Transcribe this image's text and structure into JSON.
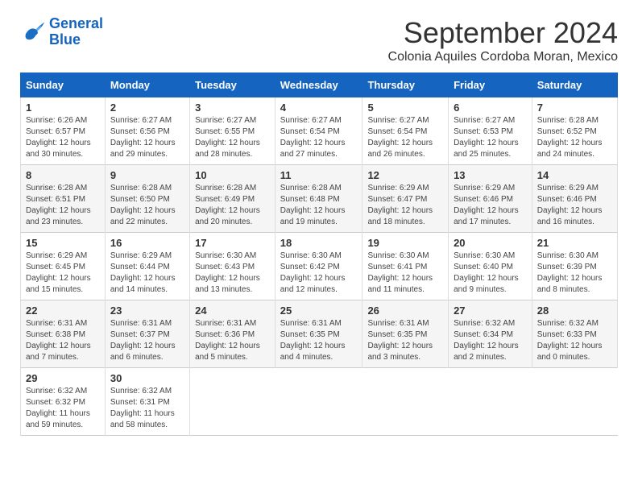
{
  "logo": {
    "line1": "General",
    "line2": "Blue"
  },
  "title": "September 2024",
  "subtitle": "Colonia Aquiles Cordoba Moran, Mexico",
  "days_of_week": [
    "Sunday",
    "Monday",
    "Tuesday",
    "Wednesday",
    "Thursday",
    "Friday",
    "Saturday"
  ],
  "weeks": [
    [
      {
        "day": "1",
        "sunrise": "6:26 AM",
        "sunset": "6:57 PM",
        "daylight": "12 hours and 30 minutes."
      },
      {
        "day": "2",
        "sunrise": "6:27 AM",
        "sunset": "6:56 PM",
        "daylight": "12 hours and 29 minutes."
      },
      {
        "day": "3",
        "sunrise": "6:27 AM",
        "sunset": "6:55 PM",
        "daylight": "12 hours and 28 minutes."
      },
      {
        "day": "4",
        "sunrise": "6:27 AM",
        "sunset": "6:54 PM",
        "daylight": "12 hours and 27 minutes."
      },
      {
        "day": "5",
        "sunrise": "6:27 AM",
        "sunset": "6:54 PM",
        "daylight": "12 hours and 26 minutes."
      },
      {
        "day": "6",
        "sunrise": "6:27 AM",
        "sunset": "6:53 PM",
        "daylight": "12 hours and 25 minutes."
      },
      {
        "day": "7",
        "sunrise": "6:28 AM",
        "sunset": "6:52 PM",
        "daylight": "12 hours and 24 minutes."
      }
    ],
    [
      {
        "day": "8",
        "sunrise": "6:28 AM",
        "sunset": "6:51 PM",
        "daylight": "12 hours and 23 minutes."
      },
      {
        "day": "9",
        "sunrise": "6:28 AM",
        "sunset": "6:50 PM",
        "daylight": "12 hours and 22 minutes."
      },
      {
        "day": "10",
        "sunrise": "6:28 AM",
        "sunset": "6:49 PM",
        "daylight": "12 hours and 20 minutes."
      },
      {
        "day": "11",
        "sunrise": "6:28 AM",
        "sunset": "6:48 PM",
        "daylight": "12 hours and 19 minutes."
      },
      {
        "day": "12",
        "sunrise": "6:29 AM",
        "sunset": "6:47 PM",
        "daylight": "12 hours and 18 minutes."
      },
      {
        "day": "13",
        "sunrise": "6:29 AM",
        "sunset": "6:46 PM",
        "daylight": "12 hours and 17 minutes."
      },
      {
        "day": "14",
        "sunrise": "6:29 AM",
        "sunset": "6:46 PM",
        "daylight": "12 hours and 16 minutes."
      }
    ],
    [
      {
        "day": "15",
        "sunrise": "6:29 AM",
        "sunset": "6:45 PM",
        "daylight": "12 hours and 15 minutes."
      },
      {
        "day": "16",
        "sunrise": "6:29 AM",
        "sunset": "6:44 PM",
        "daylight": "12 hours and 14 minutes."
      },
      {
        "day": "17",
        "sunrise": "6:30 AM",
        "sunset": "6:43 PM",
        "daylight": "12 hours and 13 minutes."
      },
      {
        "day": "18",
        "sunrise": "6:30 AM",
        "sunset": "6:42 PM",
        "daylight": "12 hours and 12 minutes."
      },
      {
        "day": "19",
        "sunrise": "6:30 AM",
        "sunset": "6:41 PM",
        "daylight": "12 hours and 11 minutes."
      },
      {
        "day": "20",
        "sunrise": "6:30 AM",
        "sunset": "6:40 PM",
        "daylight": "12 hours and 9 minutes."
      },
      {
        "day": "21",
        "sunrise": "6:30 AM",
        "sunset": "6:39 PM",
        "daylight": "12 hours and 8 minutes."
      }
    ],
    [
      {
        "day": "22",
        "sunrise": "6:31 AM",
        "sunset": "6:38 PM",
        "daylight": "12 hours and 7 minutes."
      },
      {
        "day": "23",
        "sunrise": "6:31 AM",
        "sunset": "6:37 PM",
        "daylight": "12 hours and 6 minutes."
      },
      {
        "day": "24",
        "sunrise": "6:31 AM",
        "sunset": "6:36 PM",
        "daylight": "12 hours and 5 minutes."
      },
      {
        "day": "25",
        "sunrise": "6:31 AM",
        "sunset": "6:35 PM",
        "daylight": "12 hours and 4 minutes."
      },
      {
        "day": "26",
        "sunrise": "6:31 AM",
        "sunset": "6:35 PM",
        "daylight": "12 hours and 3 minutes."
      },
      {
        "day": "27",
        "sunrise": "6:32 AM",
        "sunset": "6:34 PM",
        "daylight": "12 hours and 2 minutes."
      },
      {
        "day": "28",
        "sunrise": "6:32 AM",
        "sunset": "6:33 PM",
        "daylight": "12 hours and 0 minutes."
      }
    ],
    [
      {
        "day": "29",
        "sunrise": "6:32 AM",
        "sunset": "6:32 PM",
        "daylight": "11 hours and 59 minutes."
      },
      {
        "day": "30",
        "sunrise": "6:32 AM",
        "sunset": "6:31 PM",
        "daylight": "11 hours and 58 minutes."
      },
      null,
      null,
      null,
      null,
      null
    ]
  ],
  "labels": {
    "sunrise": "Sunrise: ",
    "sunset": "Sunset: ",
    "daylight": "Daylight: "
  }
}
